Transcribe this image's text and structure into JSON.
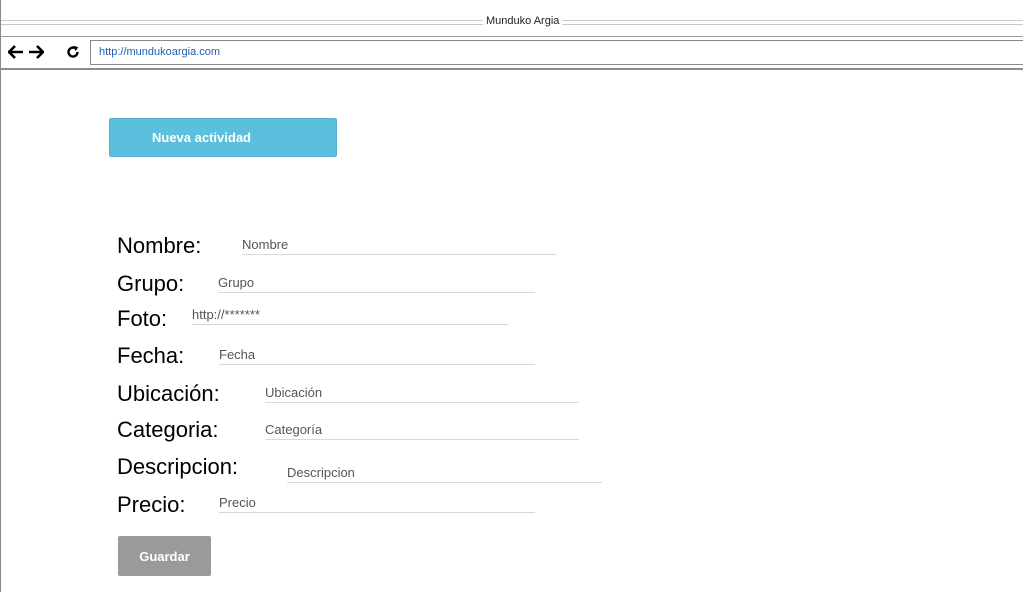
{
  "window": {
    "title": "Munduko Argia"
  },
  "browser": {
    "back_icon": "arrow-left-icon",
    "forward_icon": "arrow-right-icon",
    "reload_icon": "reload-icon",
    "url": "http://mundukoargia.com"
  },
  "actions": {
    "new_activity_label": "Nueva actividad",
    "save_label": "Guardar"
  },
  "form": {
    "name": {
      "label": "Nombre:",
      "placeholder": "Nombre"
    },
    "group": {
      "label": "Grupo:",
      "placeholder": "Grupo"
    },
    "photo": {
      "label": "Foto:",
      "placeholder": "http://*******"
    },
    "date": {
      "label": "Fecha:",
      "placeholder": "Fecha"
    },
    "location": {
      "label": "Ubicación:",
      "placeholder": "Ubicación"
    },
    "category": {
      "label": "Categoria:",
      "placeholder": "Categoría"
    },
    "description": {
      "label": "Descripcion:",
      "placeholder": "Descripcion"
    },
    "price": {
      "label": "Precio:",
      "placeholder": "Precio"
    }
  },
  "colors": {
    "primary_button": "#5bc0de",
    "save_button": "#9a9a9a",
    "url_text": "#1f5fb4"
  }
}
